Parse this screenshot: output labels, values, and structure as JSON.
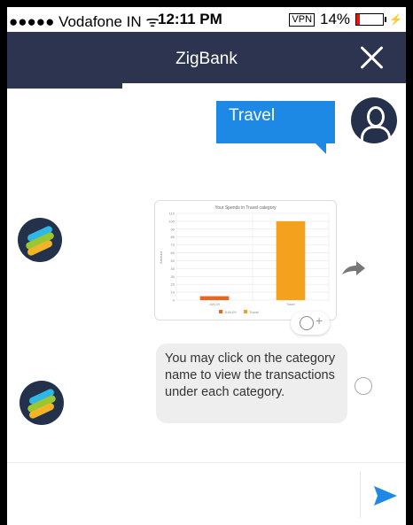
{
  "status_bar": {
    "carrier": "●●●●● Vodafone IN ᯤ",
    "time": "12:11 PM",
    "vpn": "VPN",
    "battery": "14%",
    "battery_level": 0.14,
    "bolt": "⚡"
  },
  "header": {
    "title": "ZigBank",
    "close_label": ""
  },
  "messages": {
    "user_message": "Travel",
    "bot_message": "You may click on the category name to view the transactions under each category."
  },
  "chart_data": {
    "type": "bar",
    "title": "Your Spends in Travel category",
    "categories": [
      "JUN-09",
      "Travel"
    ],
    "series": [
      {
        "name": "JUN-09",
        "values": [
          5,
          0
        ],
        "color": "#e8661e"
      },
      {
        "name": "Travel",
        "values": [
          0,
          100
        ],
        "color": "#f4a21d"
      }
    ],
    "ylabel": "Amount",
    "ylim": [
      0,
      110
    ],
    "yticks": [
      0,
      10,
      20,
      30,
      40,
      50,
      60,
      70,
      80,
      90,
      100,
      110
    ],
    "legend": [
      "JUN-09",
      "Travel"
    ]
  },
  "input": {
    "placeholder": ""
  },
  "colors": {
    "header_bg": "#2c3450",
    "user_bubble": "#1e88e5",
    "send_icon": "#1e88e5"
  }
}
